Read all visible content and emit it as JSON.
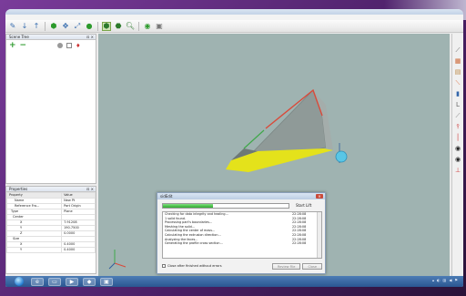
{
  "window": {
    "title": "",
    "menu": [
      "",
      "",
      "",
      "",
      "",
      "",
      "",
      ""
    ]
  },
  "scene_tree": {
    "title": "Scene Tree"
  },
  "properties": {
    "title": "Properties",
    "columns": [
      "Property",
      "Value"
    ],
    "rows": [
      [
        "Name",
        "New Pt"
      ],
      [
        "Reference Fra...",
        "Part Origin"
      ],
      [
        "Type",
        "Plane"
      ],
      [
        "Center",
        ""
      ],
      [
        "X",
        "7.91208"
      ],
      [
        "Y",
        "190.7500"
      ],
      [
        "Z",
        "0.0000"
      ],
      [
        "Size",
        ""
      ],
      [
        "X",
        "0.4000"
      ],
      [
        "Y",
        "0.4000"
      ]
    ]
  },
  "dialog": {
    "title": "sidEdit",
    "progress": 0.4,
    "stage_label": "Start Lift",
    "log": [
      {
        "msg": "Checking for data integrity and healing...",
        "time": "22:28:08"
      },
      {
        "msg": "1 solid found.",
        "time": "22:28:08"
      },
      {
        "msg": "Processing part's boundaries...",
        "time": "22:28:08"
      },
      {
        "msg": "Meshing the solid...",
        "time": "22:28:08"
      },
      {
        "msg": "Calculating the center of mass...",
        "time": "22:28:08"
      },
      {
        "msg": "Calculating the extrusion direction...",
        "time": "22:28:08"
      },
      {
        "msg": "Analyzing the faces...",
        "time": "22:28:08"
      },
      {
        "msg": "Generating the profile cross section...",
        "time": "22:28:08"
      }
    ],
    "checkbox_label": "Close after finished without errors",
    "buttons": [
      "Review File",
      "Close"
    ]
  },
  "colors": {
    "viewport_bg": "#9fb3b1",
    "model_face": "#8f9a98",
    "model_top_edge": "#d94a3a",
    "model_green_edge": "#3fa84a",
    "model_bottom": "#e4e21b",
    "pivot": "#59c6e6",
    "progress": "#2eaa2e",
    "taskbar": "#2a5691"
  }
}
